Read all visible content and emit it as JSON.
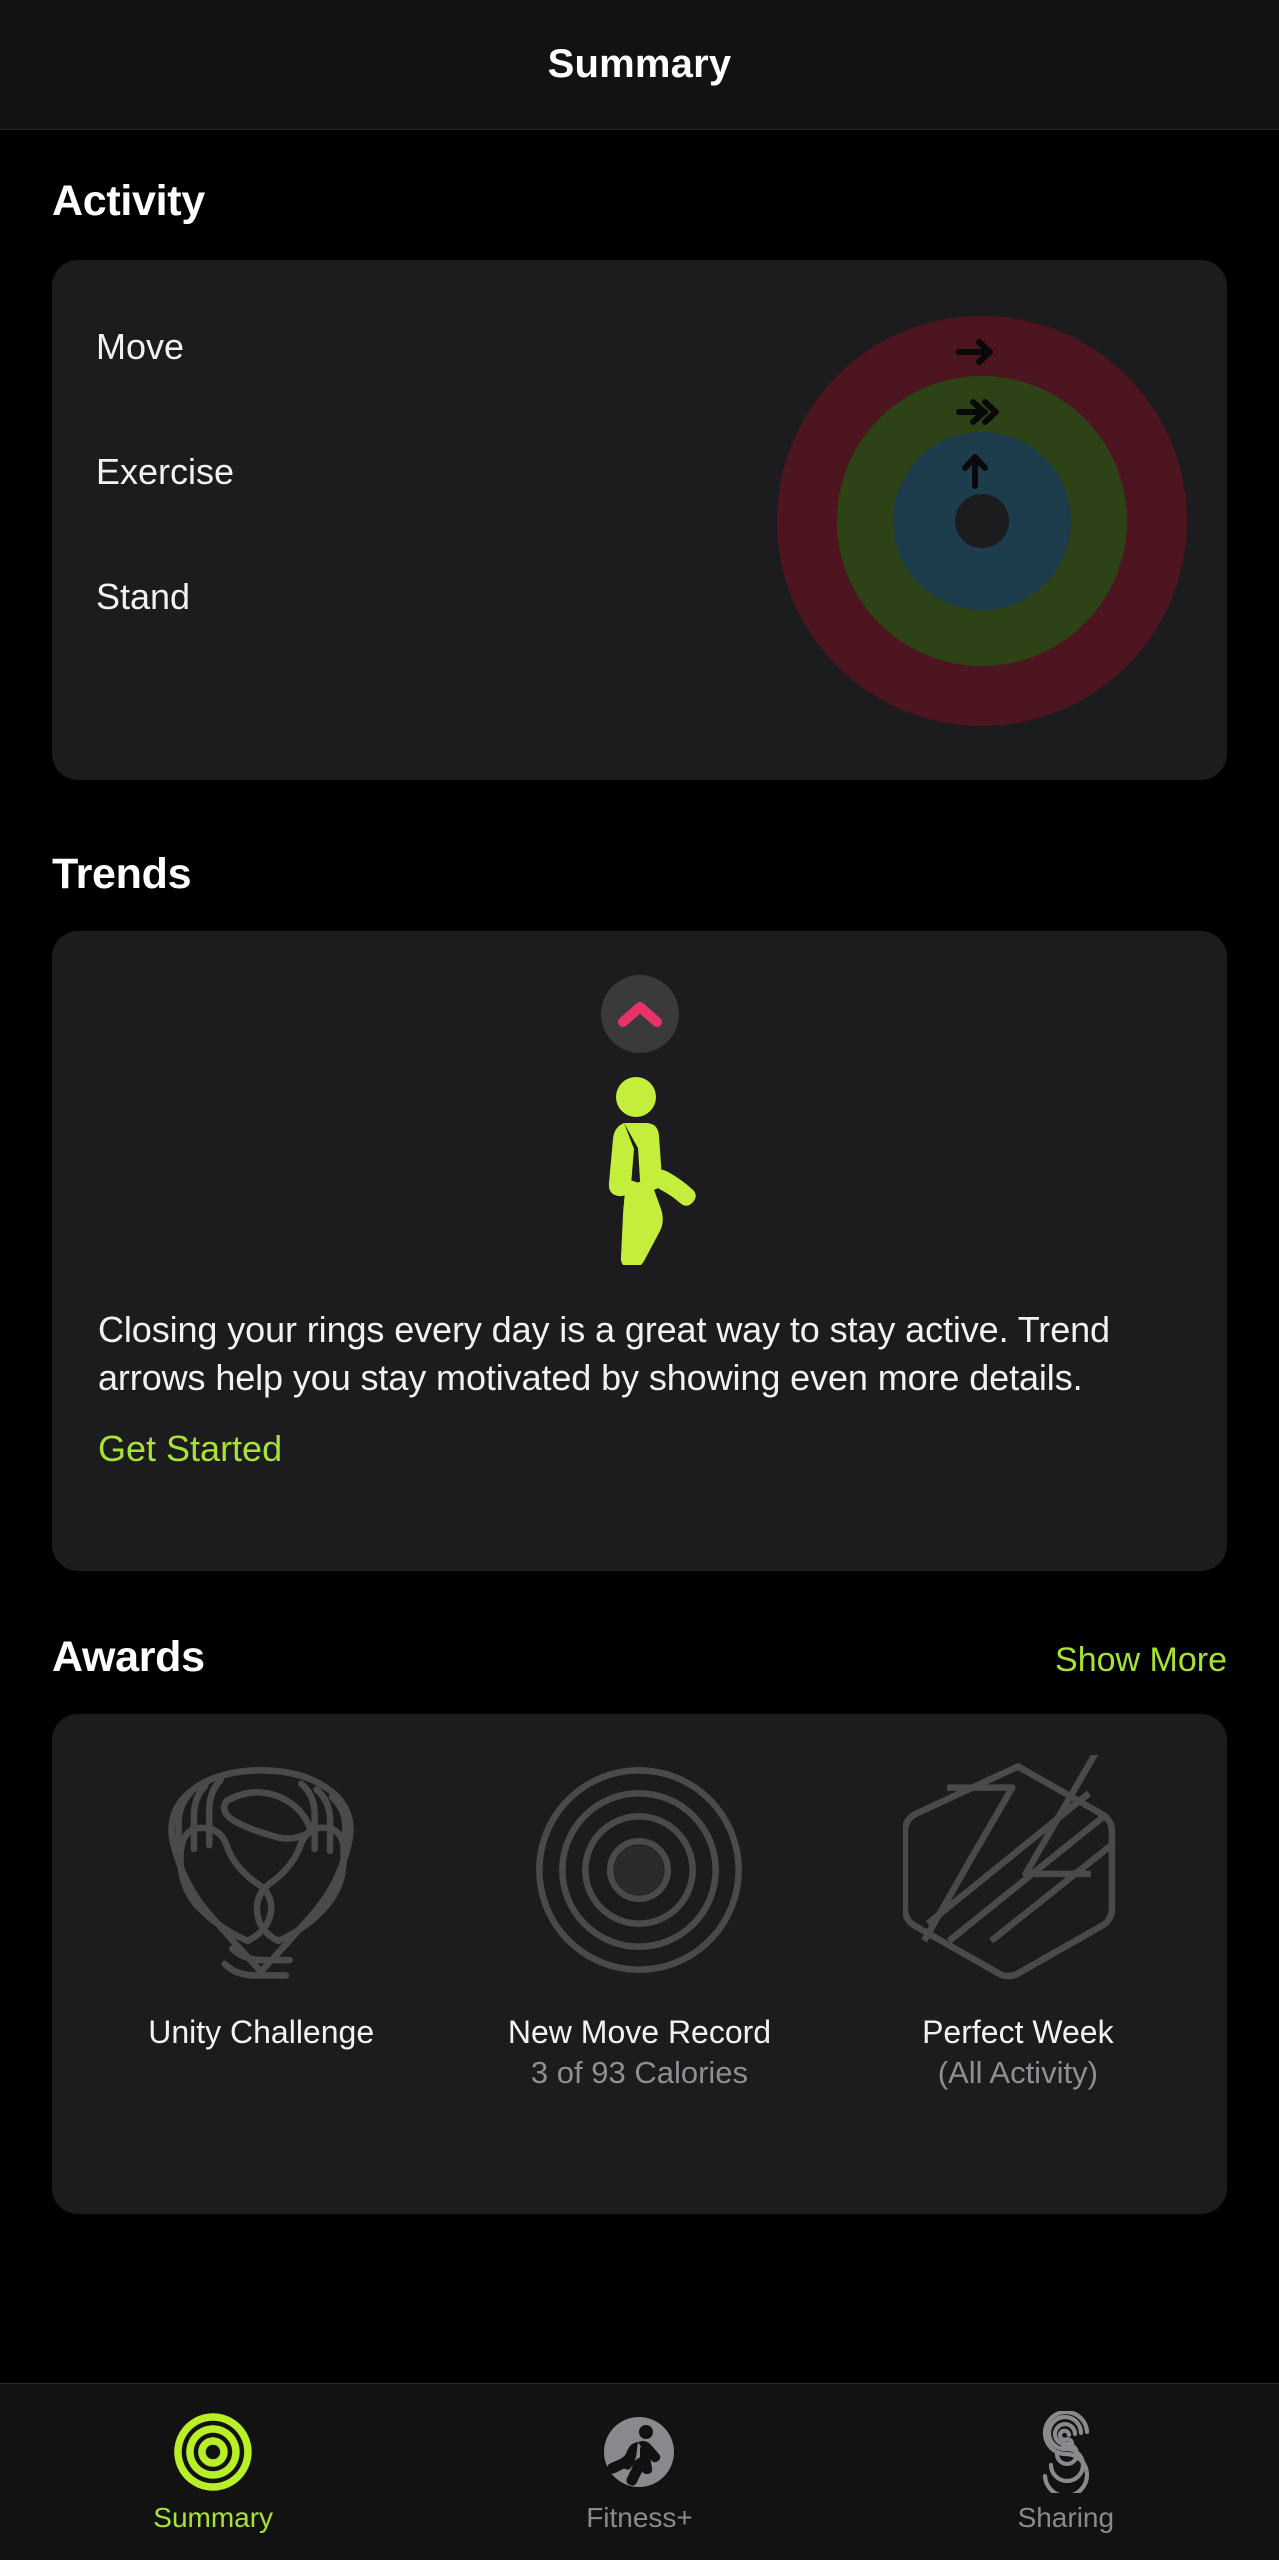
{
  "navbar": {
    "title": "Summary"
  },
  "activity": {
    "section_title": "Activity",
    "rings": [
      {
        "label": "Move",
        "icon": "arrow-right-icon",
        "color": "#4d1520"
      },
      {
        "label": "Exercise",
        "icon": "double-arrow-right-icon",
        "color": "#2d4317"
      },
      {
        "label": "Stand",
        "icon": "arrow-up-icon",
        "color": "#1d3c4c"
      }
    ]
  },
  "trends": {
    "section_title": "Trends",
    "chevron_icon": "chevron-up-icon",
    "chevron_color": "#e8326a",
    "figure_icon": "walking-person-icon",
    "figure_color": "#c3ef3c",
    "description": "Closing your rings every day is a great way to stay active. Trend arrows help you stay motivated by showing even more details.",
    "link_label": "Get Started",
    "link_color": "#a8e234"
  },
  "awards": {
    "section_title": "Awards",
    "show_more_label": "Show More",
    "items": [
      {
        "badge_icon": "unity-hands-badge-icon",
        "title": "Unity Challenge",
        "subtitle": ""
      },
      {
        "badge_icon": "target-rings-badge-icon",
        "title": "New Move Record",
        "subtitle": "3 of 93 Calories"
      },
      {
        "badge_icon": "hex-bolt-badge-icon",
        "title": "Perfect Week",
        "subtitle": "(All Activity)"
      }
    ]
  },
  "tabbar": {
    "tabs": [
      {
        "label": "Summary",
        "icon": "activity-rings-icon",
        "active": true
      },
      {
        "label": "Fitness+",
        "icon": "running-person-icon",
        "active": false
      },
      {
        "label": "Sharing",
        "icon": "sharing-s-icon",
        "active": false
      }
    ]
  }
}
